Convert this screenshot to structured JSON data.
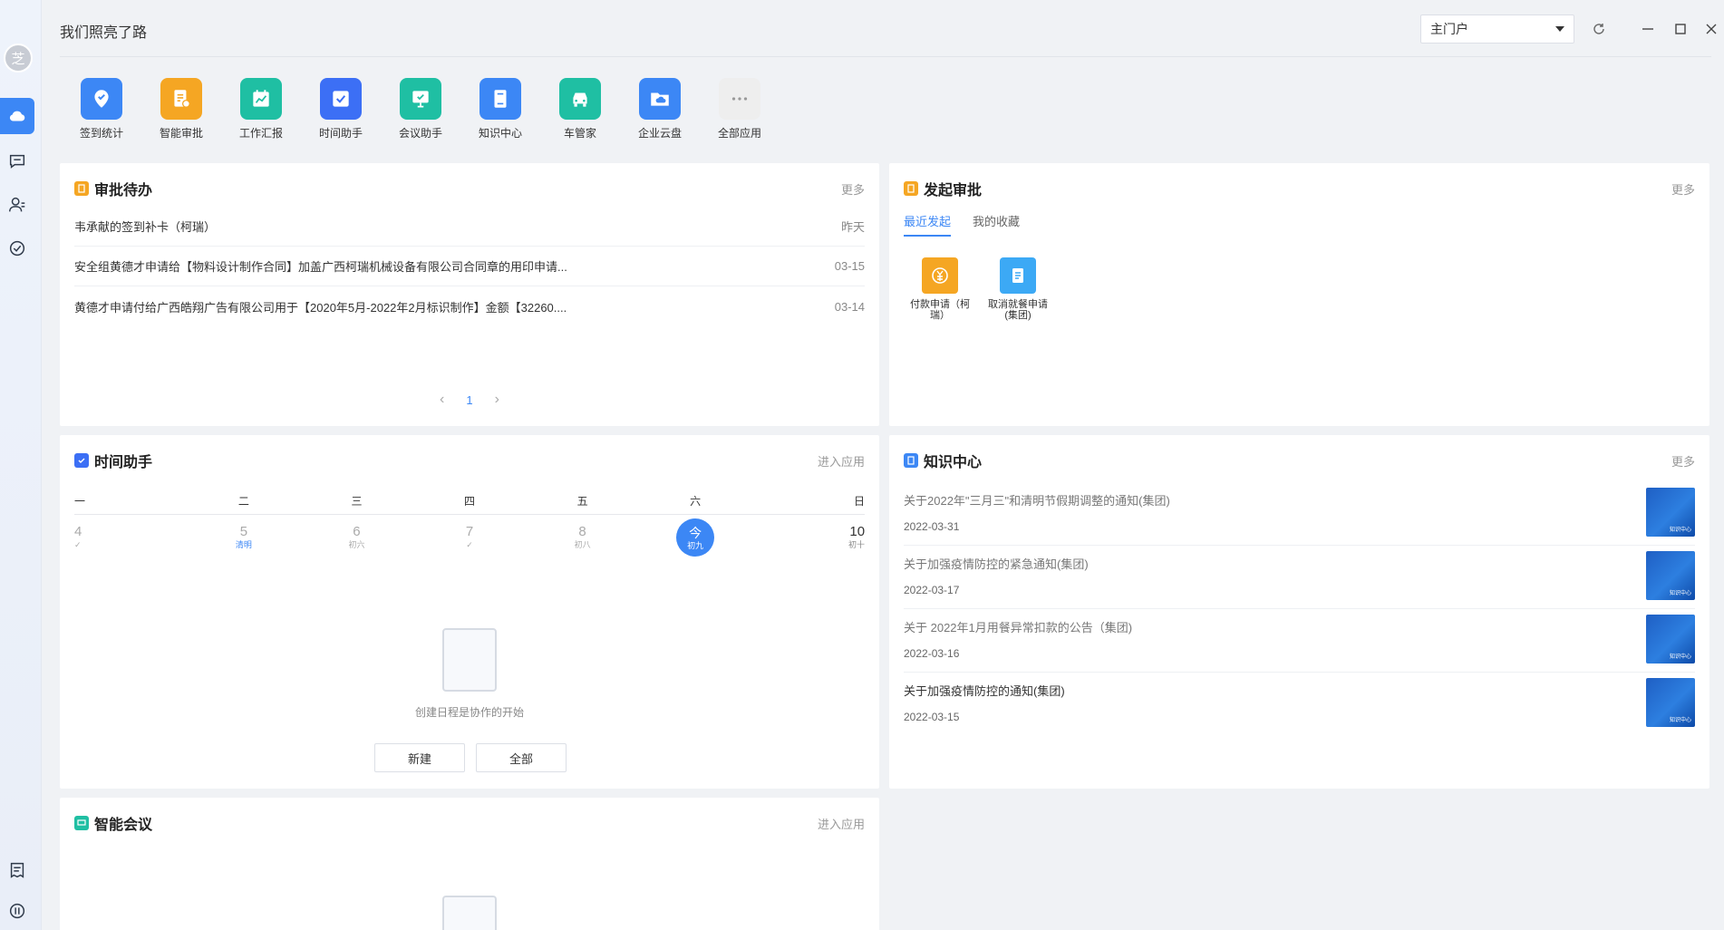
{
  "topbar": {
    "title": "我们照亮了路",
    "portal": "主门户"
  },
  "rail": {
    "avatar_text": "芝"
  },
  "apps": [
    {
      "label": "签到统计",
      "icon": "location-pin-icon",
      "color": "#3c87f5"
    },
    {
      "label": "智能审批",
      "icon": "approval-doc-icon",
      "color": "#f5a623"
    },
    {
      "label": "工作汇报",
      "icon": "report-chart-icon",
      "color": "#1fbfa3"
    },
    {
      "label": "时间助手",
      "icon": "calendar-check-icon",
      "color": "#3c6ff5"
    },
    {
      "label": "会议助手",
      "icon": "meeting-screen-icon",
      "color": "#1fbfa3"
    },
    {
      "label": "知识中心",
      "icon": "book-icon",
      "color": "#3c87f5"
    },
    {
      "label": "车管家",
      "icon": "car-icon",
      "color": "#1fbfa3"
    },
    {
      "label": "企业云盘",
      "icon": "cloud-folder-icon",
      "color": "#3c87f5"
    },
    {
      "label": "全部应用",
      "icon": "more-dots-icon",
      "color": "#eeeeee"
    }
  ],
  "approval_todo": {
    "title": "审批待办",
    "more": "更多",
    "items": [
      {
        "text": "韦承献的签到补卡（柯瑞）",
        "date": "昨天"
      },
      {
        "text": "安全组黄德才申请给【物料设计制作合同】加盖广西柯瑞机械设备有限公司合同章的用印申请...",
        "date": "03-15"
      },
      {
        "text": "黄德才申请付给广西皓翔广告有限公司用于【2020年5月-2022年2月标识制作】金额【32260....",
        "date": "03-14"
      }
    ],
    "page": "1",
    "prev": "‹",
    "next": "›"
  },
  "start_approval": {
    "title": "发起审批",
    "more": "更多",
    "tabs": [
      "最近发起",
      "我的收藏"
    ],
    "flows": [
      {
        "label": "付款申请（柯瑞）",
        "icon": "yuan-icon",
        "color": "#f5a623"
      },
      {
        "label": "取消就餐申请(集团)",
        "icon": "clipboard-icon",
        "color": "#3ca9f5"
      }
    ]
  },
  "time_assistant": {
    "title": "时间助手",
    "more": "进入应用",
    "weekdays": [
      "一",
      "二",
      "三",
      "四",
      "五",
      "六",
      "日"
    ],
    "days": [
      {
        "n": "4",
        "sub": "✓"
      },
      {
        "n": "5",
        "sub": "清明"
      },
      {
        "n": "6",
        "sub": "初六"
      },
      {
        "n": "7",
        "sub": "✓"
      },
      {
        "n": "8",
        "sub": "初八"
      },
      {
        "n": "今",
        "sub": "初九"
      },
      {
        "n": "10",
        "sub": "初十"
      }
    ],
    "empty_text": "创建日程是协作的开始",
    "new_btn": "新建",
    "all_btn": "全部"
  },
  "knowledge": {
    "title": "知识中心",
    "more": "更多",
    "thumb_tag": "知识中心",
    "items": [
      {
        "title": "关于2022年\"三月三\"和清明节假期调整的通知(集团)",
        "date": "2022-03-31"
      },
      {
        "title": "关于加强疫情防控的紧急通知(集团)",
        "date": "2022-03-17"
      },
      {
        "title": "关于 2022年1月用餐异常扣款的公告（集团)",
        "date": "2022-03-16"
      },
      {
        "title": "关于加强疫情防控的通知(集团)",
        "date": "2022-03-15"
      }
    ]
  },
  "meeting": {
    "title": "智能会议",
    "more": "进入应用"
  }
}
